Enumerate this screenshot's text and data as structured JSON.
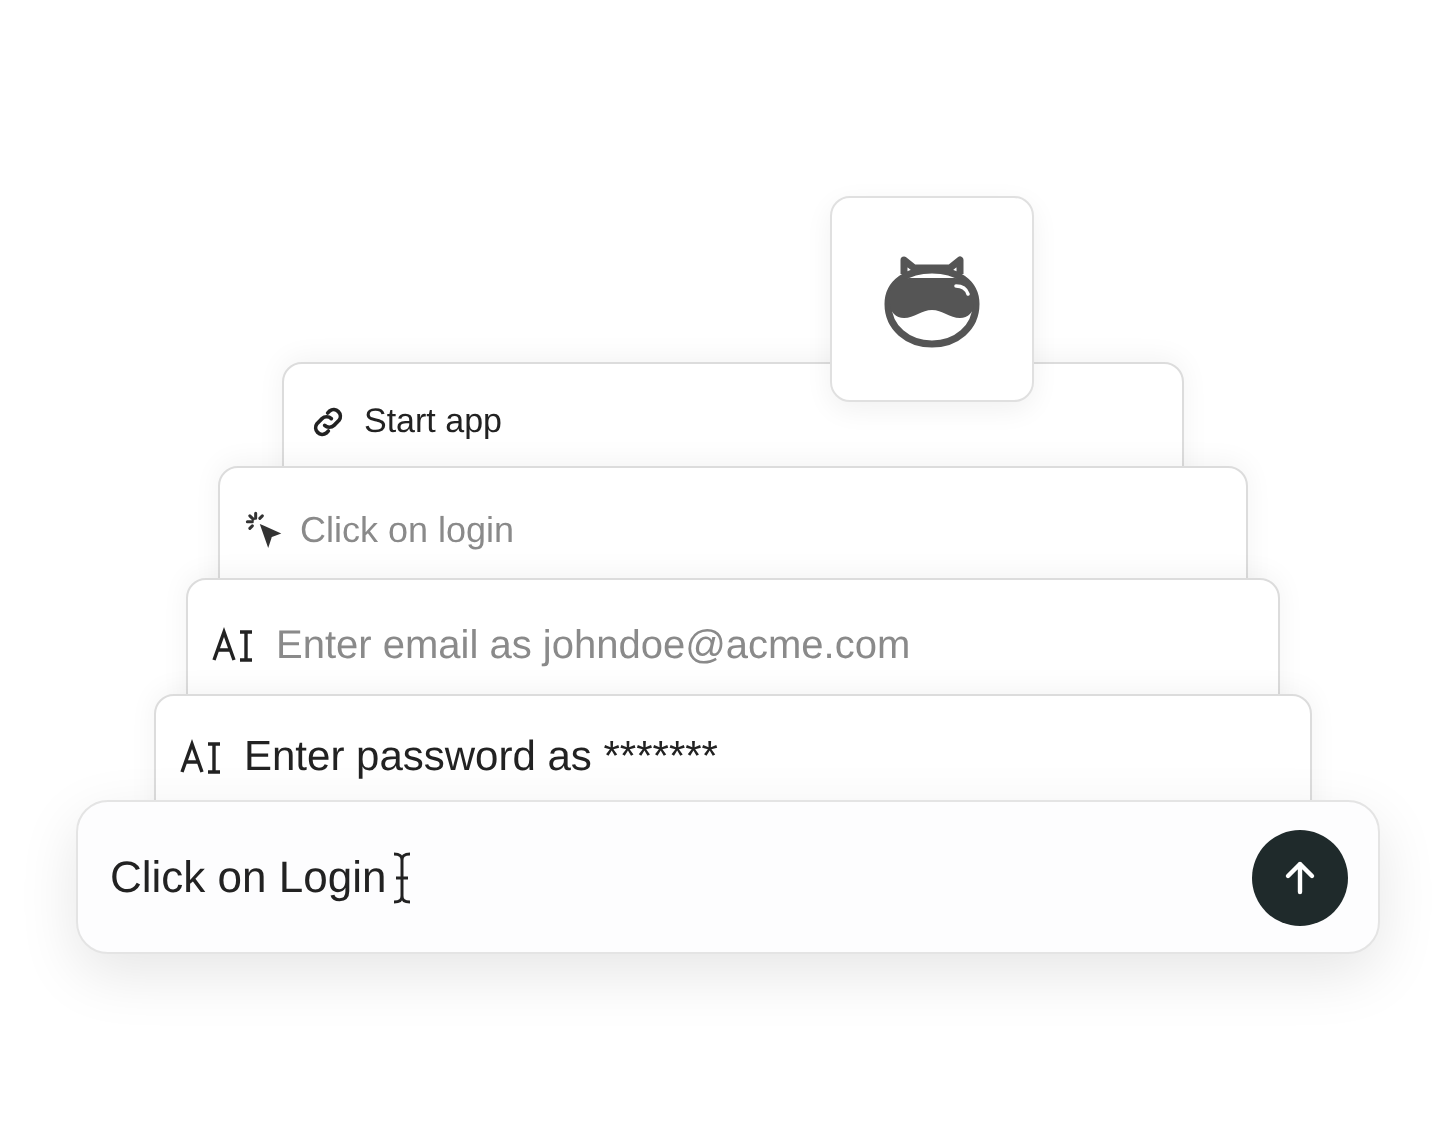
{
  "steps": [
    {
      "kind": "link",
      "label": "Start app",
      "muted": false
    },
    {
      "kind": "pointer",
      "label": "Click on login",
      "muted": true
    },
    {
      "kind": "text",
      "label": "Enter email as johndoe@acme.com",
      "muted": true
    },
    {
      "kind": "text",
      "label": "Enter password as *******",
      "muted": false
    }
  ],
  "prompt": {
    "value": "Click on Login"
  }
}
